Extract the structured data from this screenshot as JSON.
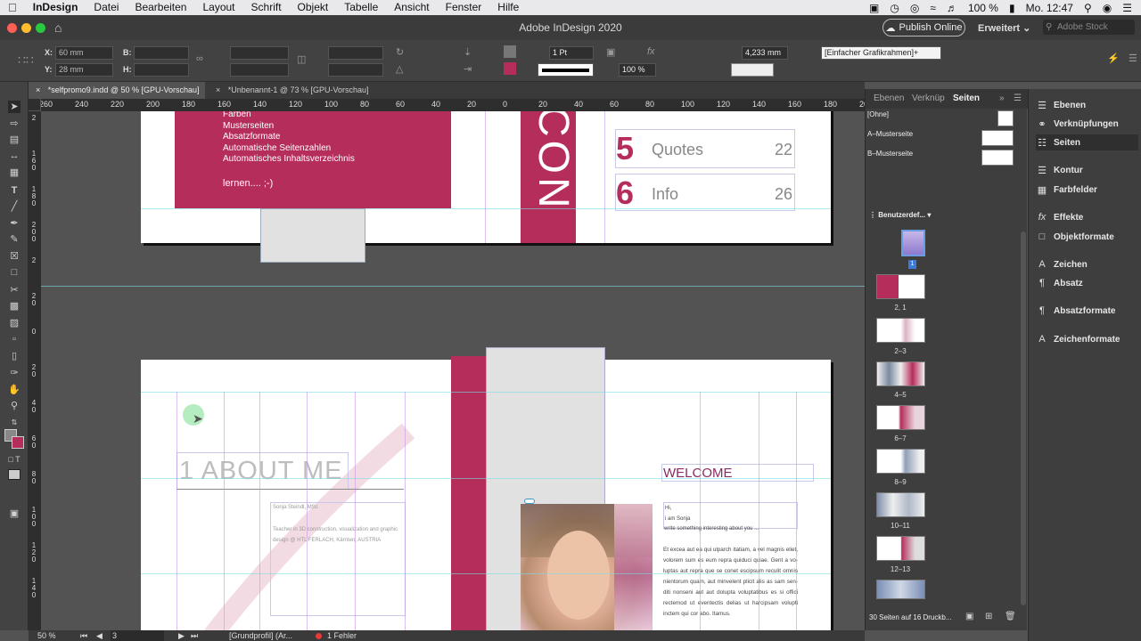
{
  "menubar": {
    "app": "InDesign",
    "items": [
      "Datei",
      "Bearbeiten",
      "Layout",
      "Schrift",
      "Objekt",
      "Tabelle",
      "Ansicht",
      "Fenster",
      "Hilfe"
    ],
    "battery": "100 %",
    "clock": "Mo. 12:47"
  },
  "window": {
    "title": "Adobe InDesign 2020",
    "publish_label": "Publish Online",
    "workspace_label": "Erweitert",
    "stock_placeholder": "Adobe Stock"
  },
  "control": {
    "x_label": "X:",
    "x_value": "60 mm",
    "y_label": "Y:",
    "y_value": "28 mm",
    "b_label": "B:",
    "h_label": "H:",
    "stroke_weight": "1 Pt",
    "scale": "100 %",
    "spacing": "4,233 mm",
    "object_style": "[Einfacher Grafikrahmen]+"
  },
  "tabs": [
    {
      "label": "*selfpromo9.indd @ 50 % [GPU-Vorschau]"
    },
    {
      "label": "*Unbenannt-1 @ 73 % [GPU-Vorschau]"
    }
  ],
  "hruler": [
    "260",
    "240",
    "220",
    "200",
    "180",
    "160",
    "140",
    "120",
    "100",
    "80",
    "60",
    "40",
    "20",
    "0",
    "20",
    "40",
    "60",
    "80",
    "100",
    "120",
    "140",
    "160",
    "180",
    "200"
  ],
  "vruler": [
    "2",
    "1 6 0",
    "1 8 0",
    "2 0 0",
    "2",
    "2 0",
    "0",
    "2 0",
    "4 0",
    "6 0",
    "8 0",
    "1 0 0",
    "1 2 0",
    "1 4 0"
  ],
  "spread1": {
    "list": [
      "Farben",
      "Musterseiten",
      "Absatzformate",
      "Automatische Seitenzahlen",
      "Automatisches Inhaltsverzeichnis"
    ],
    "learn": "lernen.... ;-)",
    "vertical_text": "CON",
    "toc": [
      {
        "num": "5",
        "label": "Quotes",
        "page": "22"
      },
      {
        "num": "6",
        "label": "Info",
        "page": "26"
      }
    ]
  },
  "spread2": {
    "heading": "1 ABOUT ME",
    "name": "Sonja Steindl, MSc",
    "bio": "Teacher in 3D construction, visualization and graphic design @ HTL FERLACH, Kärnten, AUSTRIA",
    "welcome": "WELCOME",
    "greeting": "Hi,",
    "intro": "i am Sonja",
    "tagline": "write something interesting about you ...",
    "body": "Et excea aut ea qui ulparch itatiam, a vel magnis eliet, volorem sum es eum repra quiduci quiae. Gent a vo-luptas aut repra que se conet escipsum reculit omnis nientorum quam, aut minvelent plicit alis as sam sen-diti nonseni aut aut dolupta voluptatibus es si offici rectemod ut eventectis delias ut harcipsam volupti inctem qui cor abo. Itamus."
  },
  "status": {
    "zoom": "50 %",
    "page": "3",
    "profile": "[Grundprofil] (Ar...",
    "errors": "1 Fehler"
  },
  "pages_panel": {
    "tabs": [
      "Ebenen",
      "Verknüp",
      "Seiten"
    ],
    "masters": [
      "[Ohne]",
      "A–Musterseite",
      "B–Musterseite"
    ],
    "size_label": "Benutzerdef...",
    "spreads": [
      "2, 1",
      "2–3",
      "4–5",
      "6–7",
      "8–9",
      "10–11",
      "12–13"
    ],
    "first_page_num": "1",
    "footer": "30 Seiten auf 16 Druckb..."
  },
  "dock": {
    "items": [
      "Ebenen",
      "Verknüpfungen",
      "Seiten",
      "Kontur",
      "Farbfelder",
      "Effekte",
      "Objektformate",
      "Zeichen",
      "Absatz",
      "Absatzformate",
      "Zeichenformate"
    ]
  },
  "colors": {
    "brand_magenta": "#b52d5b",
    "ui_dark": "#535353"
  }
}
